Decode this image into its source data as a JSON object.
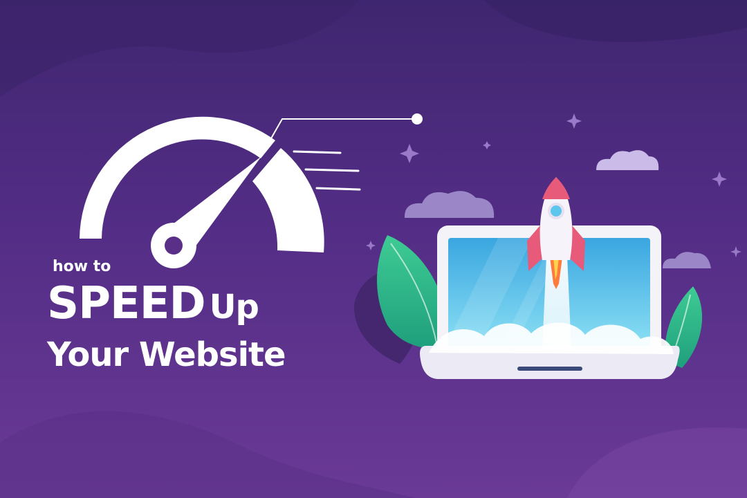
{
  "headline": {
    "kicker": "how to",
    "speed": "SPEED",
    "up": "Up",
    "site": "Your Website"
  },
  "colors": {
    "background_top": "#3f2670",
    "background_bottom": "#6a3a96",
    "text": "#ffffff",
    "screen": "#5cc6ec",
    "leaf": "#4fc89a",
    "rocket_flame": "#ff7a3d",
    "rocket_fin": "#e85a7a"
  },
  "icons": {
    "speedometer": "speedometer-gauge-icon",
    "rocket": "rocket-icon",
    "laptop": "laptop-icon"
  }
}
